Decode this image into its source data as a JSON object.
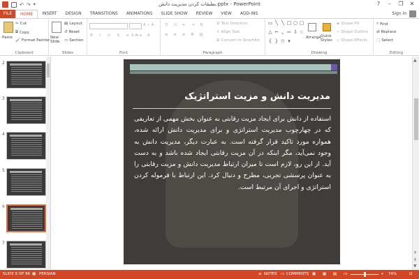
{
  "window": {
    "title": "بطبقات کردن مدیریت دانش.pptx - PowerPoint",
    "minimize": "–",
    "restore": "❐",
    "close": "✕",
    "help": "?"
  },
  "tabs": [
    "FILE",
    "HOME",
    "INSERT",
    "DESIGN",
    "TRANSITIONS",
    "ANIMATIONS",
    "SLIDE SHOW",
    "REVIEW",
    "VIEW",
    "ADD-INS"
  ],
  "signin": "Sign in",
  "ribbon": {
    "clipboard": {
      "label": "Clipboard",
      "paste": "Paste",
      "cut": "Cut",
      "copy": "Copy",
      "format_painter": "Format Painter"
    },
    "slides": {
      "label": "Slides",
      "new_slide": "New Slide",
      "layout": "Layout",
      "reset": "Reset",
      "section": "Section"
    },
    "font": {
      "label": "Font"
    },
    "paragraph": {
      "label": "Paragraph",
      "text_direction": "Text Direction",
      "align_text": "Align Text",
      "convert": "Convert to SmartArt"
    },
    "drawing": {
      "label": "Drawing",
      "arrange": "Arrange",
      "quick_styles": "Quick Styles",
      "shape_fill": "Shape Fill",
      "shape_outline": "Shape Outline",
      "shape_effects": "Shape Effects"
    },
    "editing": {
      "label": "Editing",
      "find": "Find",
      "replace": "Replace",
      "select": "Select"
    }
  },
  "thumbnails": [
    "2",
    "3",
    "4",
    "5",
    "6",
    "7"
  ],
  "slide": {
    "title": "مدیریت دانش و مزیت استراتژیک",
    "body": "استفاده از دانش برای ایجاد مزیت رقابتی به عنوان بخش مهمی از تعاریفی که در چهارچوب مدیریت استراتژی و برای مدیریت دانش ارائه شده، همواره مورد تاکید قرار گرفته است. به عبارت دیگر، مدیریت دانش به وجود نمی‌آید، مگر اینکه در آن مزیت رقابتی ایجاد شده باشد و به دست آید. از این رو، لازم است تا میزان ارتباط مدیریت دانش و مزیت رقابتی را به عنوان پرسشی تجربی، مطرح و دنبال کرد. این ارتباط با فرموله کردن استراتژی و اجرای آن مرتبط است."
  },
  "status": {
    "slide": "SLIDE 6 OF 86",
    "language": "PERSIAN",
    "notes": "NOTES",
    "comments": "COMMENTS",
    "zoom": "74%"
  },
  "colors": {
    "accent": "#d24726",
    "slide_bg": "#3f3c39"
  }
}
